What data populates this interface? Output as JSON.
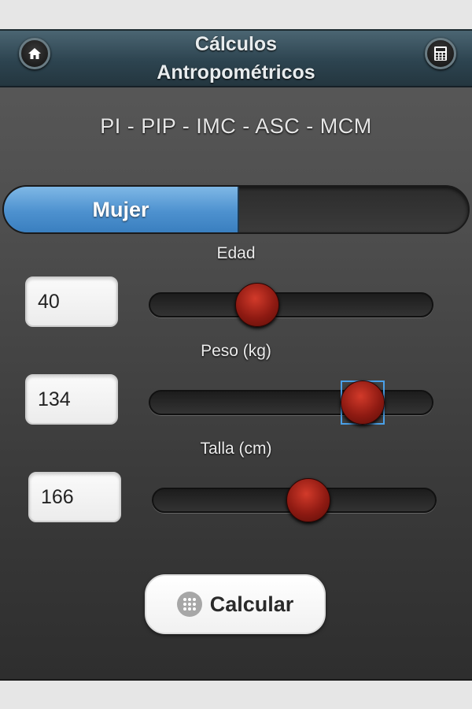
{
  "header": {
    "title": "Cálculos Antropométricos",
    "left_icon": "home-icon",
    "right_icon": "calculator-icon"
  },
  "subtitle": "PI - PIP - IMC - ASC - MCM",
  "gender_toggle": {
    "selected_label": "Mujer",
    "other_label": ""
  },
  "fields": [
    {
      "label": "Edad",
      "value": "40",
      "slider_fraction": 0.38
    },
    {
      "label": "Peso (kg)",
      "value": "134",
      "slider_fraction": 0.755
    },
    {
      "label": "Talla (cm)",
      "value": "166",
      "slider_fraction": 0.55
    }
  ],
  "calculate_button": {
    "label": "Calcular",
    "icon": "grid-icon"
  },
  "colors": {
    "accent": "#4d91cf",
    "thumb": "#a3231a",
    "header": "#2d4450"
  }
}
